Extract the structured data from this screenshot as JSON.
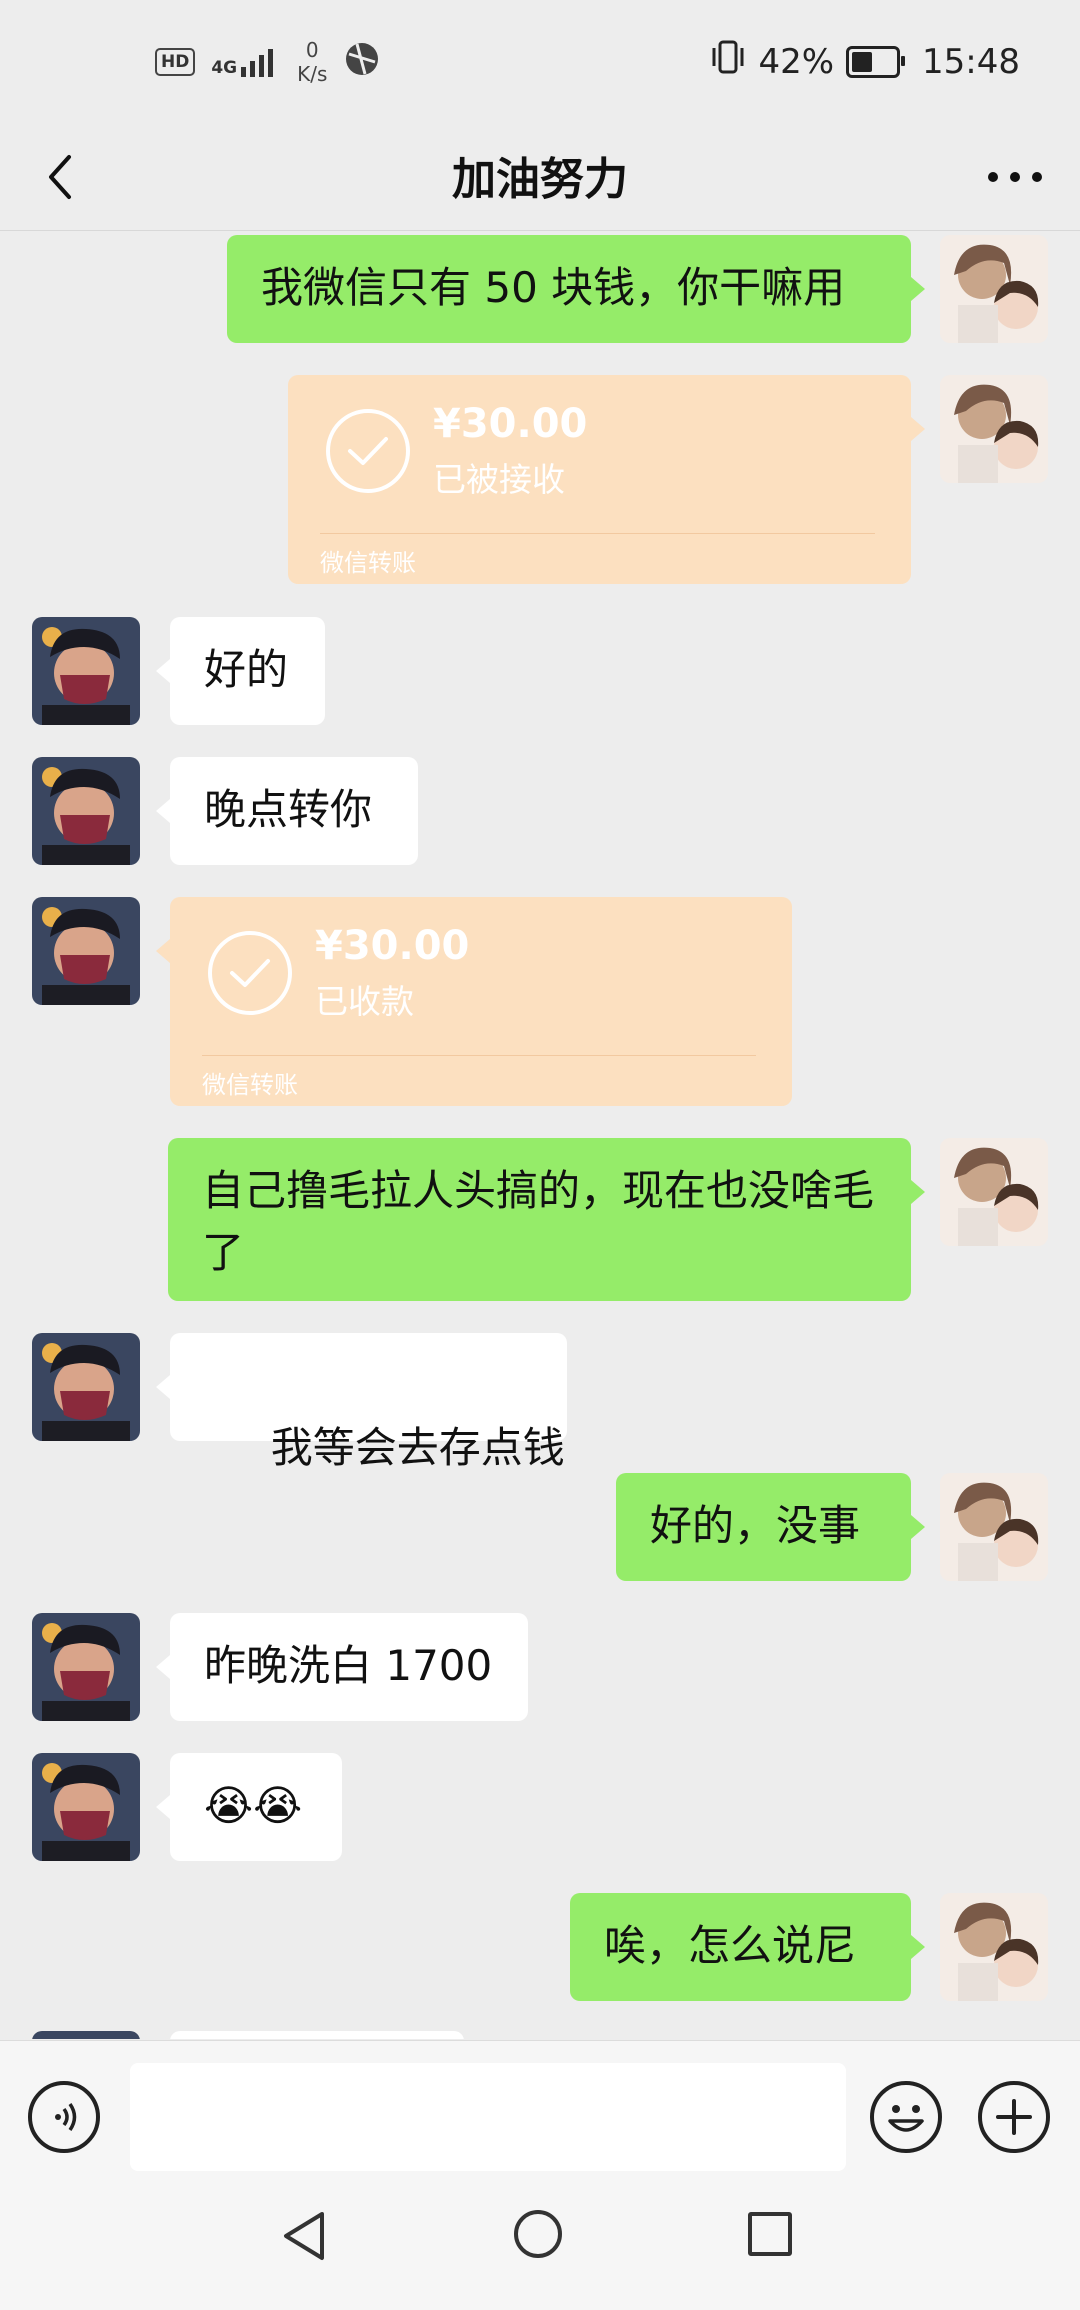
{
  "status_bar": {
    "hd_label": "HD",
    "network_label": "4G",
    "net_speed_value": "0",
    "net_speed_unit": "K/s",
    "battery_percent": "42%",
    "battery_level": 0.42,
    "time": "15:48"
  },
  "header": {
    "title": "加油努力",
    "back_icon": "chevron-left-icon",
    "more_icon": "more-dots-icon"
  },
  "messages": [
    {
      "side": "right",
      "type": "text",
      "text": "我微信只有 50 块钱，你干嘛用"
    },
    {
      "side": "right",
      "type": "transfer",
      "amount": "¥30.00",
      "status": "已被接收",
      "label": "微信转账"
    },
    {
      "side": "left",
      "type": "text",
      "text": "好的"
    },
    {
      "side": "left",
      "type": "text",
      "text": "晚点转你"
    },
    {
      "side": "left",
      "type": "transfer",
      "amount": "¥30.00",
      "status": "已收款",
      "label": "微信转账"
    },
    {
      "side": "right",
      "type": "text",
      "text": "自己撸毛拉人头搞的，现在也没啥毛了"
    },
    {
      "side": "left",
      "type": "text",
      "text": " 我等会去存点钱"
    },
    {
      "side": "right",
      "type": "text",
      "text": "好的，没事"
    },
    {
      "side": "left",
      "type": "text",
      "text": "昨晚洗白 1700"
    },
    {
      "side": "left",
      "type": "text",
      "text": "😭😭"
    },
    {
      "side": "right",
      "type": "text",
      "text": "唉，怎么说尼"
    }
  ],
  "input_bar": {
    "voice_icon": "voice-icon",
    "text_value": "",
    "emoji_icon": "emoji-icon",
    "plus_icon": "plus-icon"
  },
  "nav_bar": {
    "back_icon": "nav-back-icon",
    "home_icon": "nav-home-icon",
    "recent_icon": "nav-recent-icon"
  },
  "colors": {
    "background": "#ededed",
    "green_bubble": "#95ec69",
    "white_bubble": "#ffffff",
    "transfer_bubble": "#fce0c0"
  }
}
